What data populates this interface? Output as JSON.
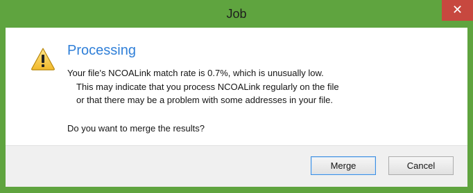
{
  "window": {
    "title": "Job",
    "close_glyph": "✕"
  },
  "dialog": {
    "icon": "warning-icon",
    "heading": "Processing",
    "message_lines": [
      "Your file's NCOALink match rate is 0.7%, which is unusually low.",
      "This may indicate that you process NCOALink regularly on the file",
      "or that there may be a problem with some addresses in your file."
    ],
    "question": "Do you want to merge the results?"
  },
  "buttons": {
    "merge": "Merge",
    "cancel": "Cancel"
  },
  "colors": {
    "frame": "#5fa43f",
    "close": "#c7483f",
    "heading": "#2f7fd8",
    "footer": "#f0f0f0"
  }
}
